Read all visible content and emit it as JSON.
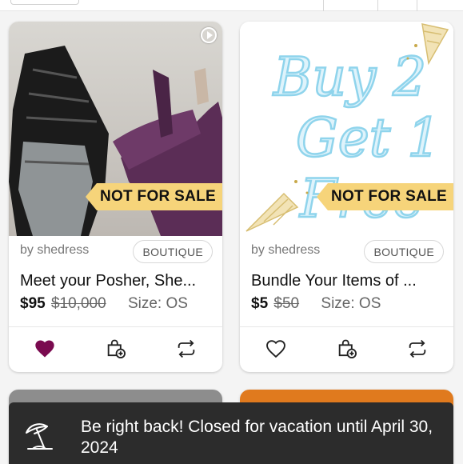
{
  "listings": [
    {
      "seller": "by shedress",
      "badge": "BOUTIQUE",
      "title": "Meet your Posher, She...",
      "price": "$95",
      "original_price": "$10,000",
      "size": "Size: OS",
      "overlay": "NOT FOR SALE",
      "liked": true,
      "has_video": true
    },
    {
      "seller": "by shedress",
      "badge": "BOUTIQUE",
      "title": "Bundle Your Items of ...",
      "price": "$5",
      "original_price": "$50",
      "size": "Size: OS",
      "overlay": "NOT FOR SALE",
      "liked": false,
      "promo_art_text": [
        "Buy 2",
        "Get 1",
        "Free"
      ]
    }
  ],
  "toast": {
    "message": "Be right back! Closed for vacation until April 30, 2024",
    "icon": "beach-umbrella-icon"
  },
  "colors": {
    "like_active": "#7a0a4f",
    "overlay_bg": "#f6d47a",
    "toast_bg": "#2c2c2c"
  }
}
